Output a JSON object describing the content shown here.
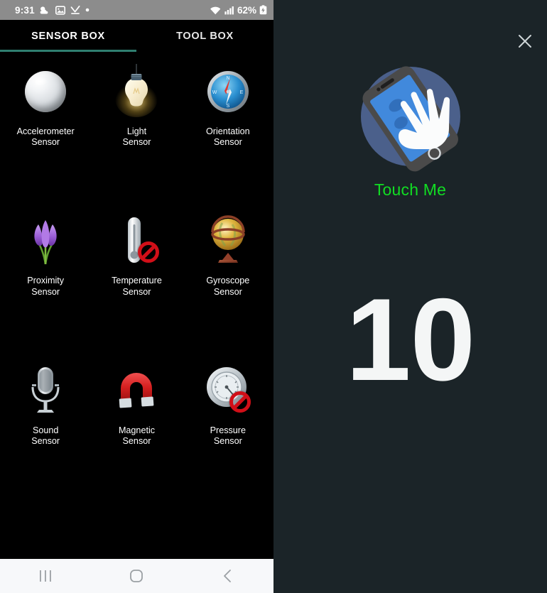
{
  "status_bar": {
    "time": "9:31",
    "battery_percent": "62%",
    "icons": [
      "weather-cloud-icon",
      "photo-gallery-icon",
      "download-complete-icon",
      "dot-indicator-icon",
      "wifi-icon",
      "cellular-signal-icon",
      "battery-icon"
    ]
  },
  "tabs": [
    {
      "label": "SENSOR BOX",
      "selected": true,
      "name": "tab-sensor-box"
    },
    {
      "label": "TOOL BOX",
      "selected": false,
      "name": "tab-tool-box"
    }
  ],
  "tab_indicator_color": "#2f7f70",
  "sensors": [
    {
      "name": "accelerometer-sensor",
      "line1": "Accelerometer",
      "line2": "Sensor",
      "icon": "silver-ball-icon",
      "disabled": false
    },
    {
      "name": "light-sensor",
      "line1": "Light",
      "line2": "Sensor",
      "icon": "light-bulb-icon",
      "disabled": false
    },
    {
      "name": "orientation-sensor",
      "line1": "Orientation",
      "line2": "Sensor",
      "icon": "compass-icon",
      "disabled": false
    },
    {
      "name": "proximity-sensor",
      "line1": "Proximity",
      "line2": "Sensor",
      "icon": "crocus-flower-icon",
      "disabled": false
    },
    {
      "name": "temperature-sensor",
      "line1": "Temperature",
      "line2": "Sensor",
      "icon": "thermometer-icon",
      "disabled": true
    },
    {
      "name": "gyroscope-sensor",
      "line1": "Gyroscope",
      "line2": "Sensor",
      "icon": "globe-gyroscope-icon",
      "disabled": false
    },
    {
      "name": "sound-sensor",
      "line1": "Sound",
      "line2": "Sensor",
      "icon": "microphone-icon",
      "disabled": false
    },
    {
      "name": "magnetic-sensor",
      "line1": "Magnetic",
      "line2": "Sensor",
      "icon": "horseshoe-magnet-icon",
      "disabled": false
    },
    {
      "name": "pressure-sensor",
      "line1": "Pressure",
      "line2": "Sensor",
      "icon": "barometer-gauge-icon",
      "disabled": true
    }
  ],
  "detail_panel": {
    "background_color": "#1b2428",
    "close_icon": "close-icon",
    "app_icon": "touch-hand-on-phone-icon",
    "title": "Touch Me",
    "title_color": "#11dd23",
    "counter_value": "10"
  },
  "nav_bar": {
    "recents_label": "recent-apps-icon",
    "home_label": "home-icon",
    "back_label": "back-icon"
  }
}
